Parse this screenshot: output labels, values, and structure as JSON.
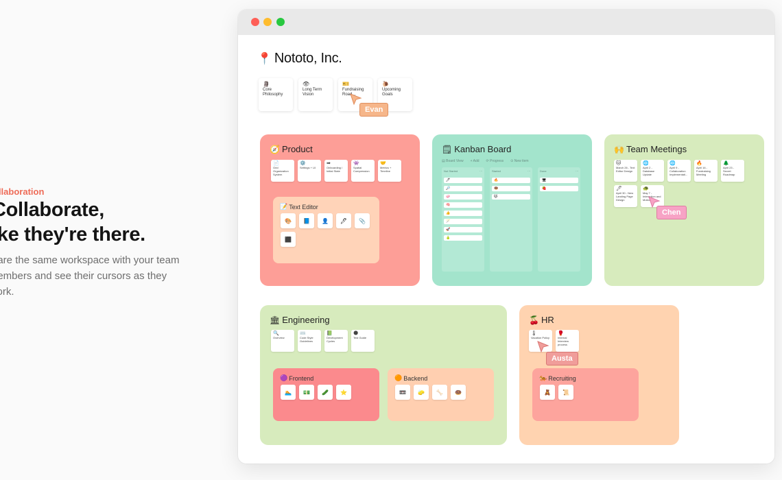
{
  "hero": {
    "eyebrow": "ollaboration",
    "title_line1": "Collaborate,",
    "title_line2": "ike they're there.",
    "body_line1": "hare the same workspace with your team",
    "body_line2": "nembers and see their cursors as they",
    "body_line3": "vork."
  },
  "window": {
    "workspace_title": "Nototo, Inc.",
    "workspace_icon": "📍"
  },
  "top_cards": [
    {
      "icon": "🗿",
      "label": "Core Philosophy"
    },
    {
      "icon": "👁",
      "label": "Long Term Vision"
    },
    {
      "icon": "🎫",
      "label": "Fundraising Road..."
    },
    {
      "icon": "🐌",
      "label": "Upcoming Goals"
    }
  ],
  "boards": {
    "product": {
      "icon": "🧭",
      "title": "Product",
      "color": "#fd9e97",
      "cards": [
        {
          "icon": "📄",
          "label": "Grid Organization System"
        },
        {
          "icon": "⚙️",
          "label": "Settings + UI"
        },
        {
          "icon": "➡",
          "label": "Onboarding / Initial State"
        },
        {
          "icon": "👾",
          "label": "Spatial Compression"
        },
        {
          "icon": "🤝",
          "label": "Metrics + Timeline"
        }
      ],
      "sub": {
        "icon": "📝",
        "title": "Text Editor",
        "color": "#ffd3b8",
        "icons": [
          "🎨",
          "📘",
          "👤",
          "🖊",
          "📎",
          "⬛"
        ]
      }
    },
    "kanban": {
      "icon": "🗒",
      "title": "Kanban Board",
      "color": "#a3e4cc",
      "toolbar": [
        "▤ Board View",
        "+ Add",
        "⟳ Progress",
        "⊙ New item"
      ],
      "columns": [
        {
          "head": "Not Started",
          "items": [
            "🖊",
            "🔎",
            "🧼",
            "🧠",
            "👍",
            "🪄",
            "🚀",
            "🍐"
          ]
        },
        {
          "head": "Started",
          "items": [
            "🔥",
            "🍩",
            "🐱"
          ]
        },
        {
          "head": "Done",
          "items": [
            "🖥",
            "🍓"
          ]
        }
      ]
    },
    "meetings": {
      "icon": "🙌",
      "title": "Team Meetings",
      "color": "#d7ebbd",
      "cards": [
        {
          "icon": "🐱",
          "label": "March 26 - Text Editor Design"
        },
        {
          "icon": "🌐",
          "label": "April 2 - Database Update"
        },
        {
          "icon": "🌐",
          "label": "April 9 - Collaboration Implementati..."
        },
        {
          "icon": "🔥",
          "label": "April 16 - Fundraising Meeting"
        },
        {
          "icon": "🌲",
          "label": "April 23 - Secret Roadmap"
        },
        {
          "icon": "🖊",
          "label": "April 30 - New Landing Page Design"
        },
        {
          "icon": "🐢",
          "label": "May 7 - Interaction and Motion"
        }
      ]
    },
    "engineering": {
      "icon": "🏛",
      "title": "Engineering",
      "color": "#d7ebbd",
      "cards": [
        {
          "icon": "🔍",
          "label": "Overview"
        },
        {
          "icon": "⌨️",
          "label": "Code Style Guidelines"
        },
        {
          "icon": "📗",
          "label": "Development Cycles"
        },
        {
          "icon": "🌑",
          "label": "Test Guide"
        }
      ],
      "frontend": {
        "icon": "🟣",
        "title": "Frontend",
        "color": "#fb8a8d",
        "icons": [
          "🏊",
          "💵",
          "🥒",
          "⭐"
        ]
      },
      "backend": {
        "icon": "🟠",
        "title": "Backend",
        "color": "#ffcfb0",
        "icons": [
          "📼",
          "🧽",
          "🦴",
          "🍩"
        ]
      }
    },
    "hr": {
      "icon": "🍒",
      "title": "HR",
      "color": "#ffd3b0",
      "cards": [
        {
          "icon": "🌡",
          "label": "Vacation Policy"
        },
        {
          "icon": "🥊",
          "label": "Internal Interview process"
        }
      ],
      "recruiting": {
        "icon": "🐅",
        "title": "Recruiting",
        "color": "#fda49d",
        "icons": [
          "🧸",
          "📜"
        ]
      }
    }
  },
  "cursors": [
    {
      "name": "Evan",
      "color": "#f6b68a",
      "border": "#e09060"
    },
    {
      "name": "Chen",
      "color": "#f7a3c5",
      "border": "#e07aa3"
    },
    {
      "name": "Austa",
      "color": "#f09d9a",
      "border": "#d97673"
    }
  ]
}
